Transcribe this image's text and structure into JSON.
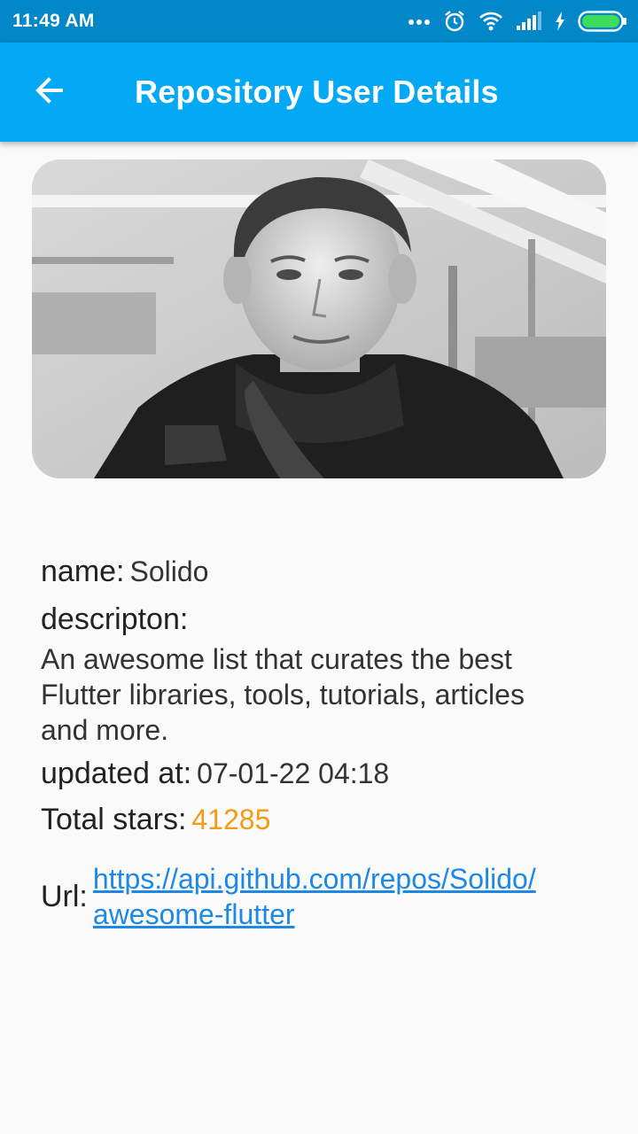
{
  "status_bar": {
    "time": "11:49 AM",
    "icons": [
      "more-dots-icon",
      "alarm-icon",
      "wifi-icon",
      "signal-icon",
      "charging-icon",
      "battery-icon"
    ]
  },
  "app_bar": {
    "title": "Repository User Details",
    "back_icon": "back-arrow-icon"
  },
  "avatar": {
    "description_icon": "user-avatar-photo"
  },
  "details": {
    "name_label": "name:",
    "name_value": "Solido",
    "description_label": "descripton:",
    "description_value": "An awesome list that curates the best Flutter libraries, tools, tutorials, articles and more.",
    "updated_label": "updated at:",
    "updated_value": "07-01-22 04:18",
    "stars_label": "Total stars:",
    "stars_value": "41285",
    "url_label": "Url:",
    "url_line1": "https://api.github.com/repos/Solido/",
    "url_line2": "awesome-flutter"
  },
  "colors": {
    "status_bar": "#0288c9",
    "app_bar": "#03a9f4",
    "stars": "#f39c12",
    "link": "#1e88e5",
    "background": "#fafafa"
  }
}
